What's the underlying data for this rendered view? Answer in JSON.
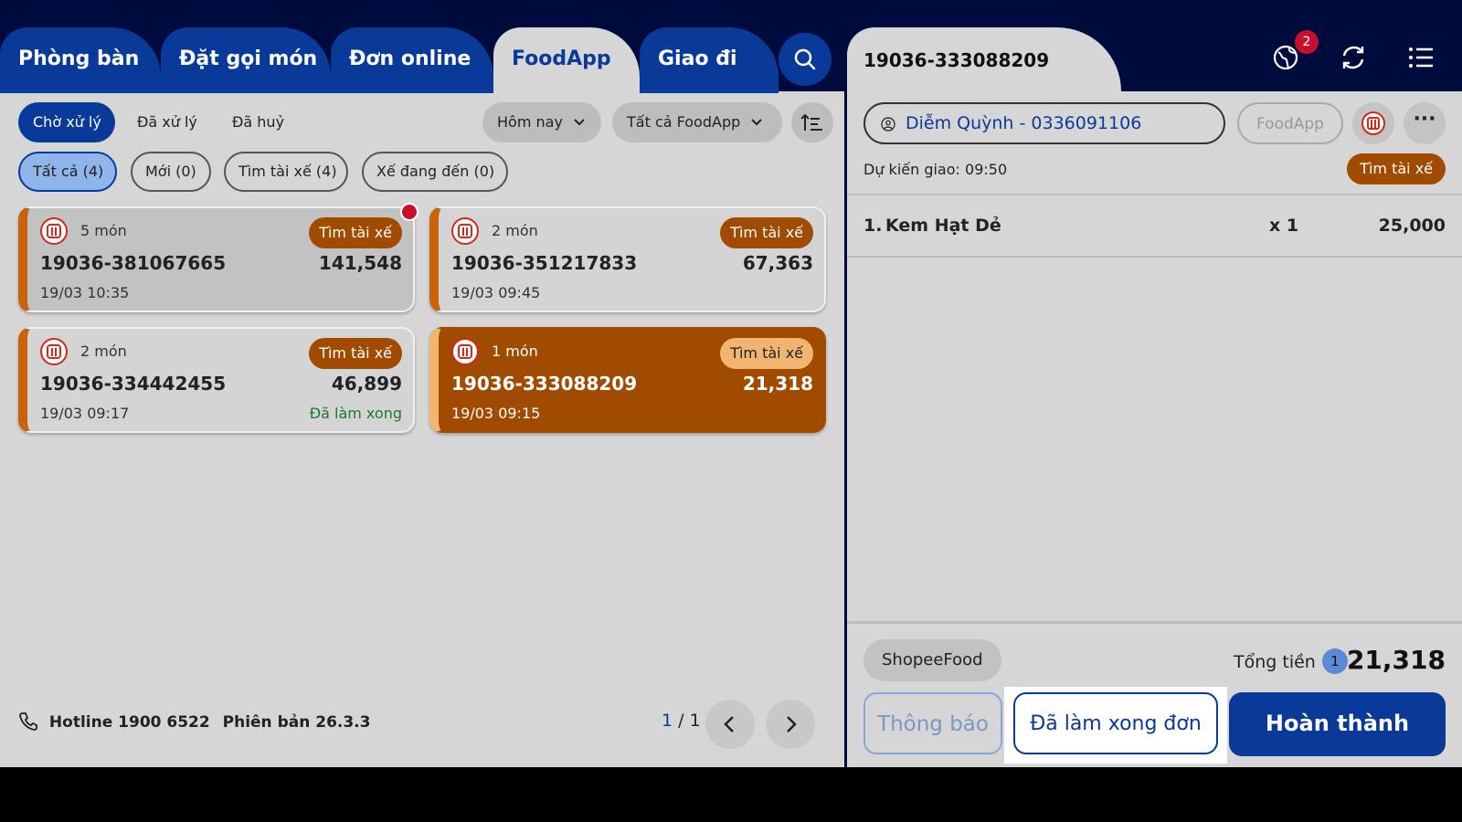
{
  "tabs": [
    "Phòng bàn",
    "Đặt gọi món",
    "Đơn online",
    "FoodApp",
    "Giao đi"
  ],
  "filters": {
    "pending": "Chờ xử lý",
    "processed": "Đã xử lý",
    "cancelled": "Đã huỷ",
    "date": "Hôm nay",
    "source": "Tất cả FoodApp"
  },
  "subfilters": [
    "Tất cả (4)",
    "Mới (0)",
    "Tìm tài xế (4)",
    "Xế đang đến (0)"
  ],
  "orders": [
    {
      "items": "5 món",
      "status": "Tìm tài xế",
      "code": "19036-381067665",
      "amount": "141,548",
      "time": "19/03 10:35",
      "note": ""
    },
    {
      "items": "2 món",
      "status": "Tìm tài xế",
      "code": "19036-351217833",
      "amount": "67,363",
      "time": "19/03 09:45",
      "note": ""
    },
    {
      "items": "2 món",
      "status": "Tìm tài xế",
      "code": "19036-334442455",
      "amount": "46,899",
      "time": "19/03 09:17",
      "note": "Đã làm xong"
    },
    {
      "items": "1 món",
      "status": "Tìm tài xế",
      "code": "19036-333088209",
      "amount": "21,318",
      "time": "19/03 09:15",
      "note": ""
    }
  ],
  "footer": {
    "hotline": "Hotline 1900 6522",
    "version": "Phiên bản 26.3.3",
    "page_current": "1",
    "page_total": "/ 1"
  },
  "detail": {
    "order_code": "19036-333088209",
    "notifications": "2",
    "customer": "Diễm Quỳnh - 0336091106",
    "source_btn": "FoodApp",
    "eta_label": "Dự kiến giao:",
    "eta_time": "09:50",
    "status": "Tìm tài xế",
    "item": {
      "index": "1.",
      "name": "Kem Hạt Dẻ",
      "qty": "x 1",
      "price": "25,000"
    },
    "channel": "ShopeeFood",
    "total_label": "Tổng tiền",
    "total_count": "1",
    "total_amount": "21,318",
    "btn_notify": "Thông báo",
    "btn_done": "Đã làm xong đơn",
    "btn_complete": "Hoàn thành"
  },
  "colors": {
    "nav": "#000b3d",
    "primary": "#0a3a99",
    "accent": "#a04b00",
    "accent_light": "#f2b56f",
    "panel": "#d6d6d6"
  },
  "icons": [
    "search-icon",
    "globe-icon",
    "refresh-icon",
    "menu-icon",
    "chevron-down-icon",
    "sort-icon",
    "phone-icon",
    "chevron-left-icon",
    "chevron-right-icon",
    "user-icon",
    "restaurant-icon",
    "more-icon"
  ]
}
